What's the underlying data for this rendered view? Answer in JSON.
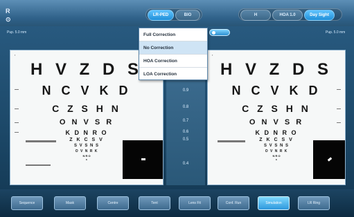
{
  "topbar": {
    "left_icon": "R ⊙",
    "mode_tabs": [
      {
        "label": "LR-PED",
        "active": true
      },
      {
        "label": "BIO",
        "active": false
      }
    ],
    "view_tabs": [
      {
        "label": "H",
        "active": false
      },
      {
        "label": "HOA 1.0",
        "active": false
      },
      {
        "label": "Day Sight",
        "active": true
      }
    ]
  },
  "labels": {
    "left_small": "Pup. 5.0 mm",
    "right_small": "Pup. 5.0 mm"
  },
  "dropdown": {
    "items": [
      {
        "label": "Full Correction",
        "selected": false
      },
      {
        "label": "No Correction",
        "selected": true
      },
      {
        "label": "HOA Correction",
        "selected": false
      },
      {
        "label": "LOA Correction",
        "selected": false
      }
    ]
  },
  "chart": {
    "rows": [
      "H V Z D S",
      "N C V K D",
      "C Z S H N",
      "O N V S R",
      "K D N R O",
      "Z K C S V",
      "S V S N S",
      "O V N R K",
      "N R O",
      "K"
    ],
    "acuity": [
      "0.9",
      "0.8",
      "0.7",
      "0.6",
      "0.5",
      "0.4"
    ]
  },
  "bottombar": {
    "buttons": [
      {
        "label": "Sequence",
        "active": false
      },
      {
        "label": "Mask",
        "active": false
      },
      {
        "label": "Centre",
        "active": false
      },
      {
        "label": "Tent",
        "active": false
      },
      {
        "label": "Lens Fit",
        "active": false
      },
      {
        "label": "Conf. Run",
        "active": false
      },
      {
        "label": "Simulation",
        "active": true
      },
      {
        "label": "LR Ring",
        "active": false
      }
    ]
  },
  "colors": {
    "accent": "#2d97dc",
    "panel_bg": "#f6f8f8",
    "bar_bg": "#2b5e85"
  }
}
